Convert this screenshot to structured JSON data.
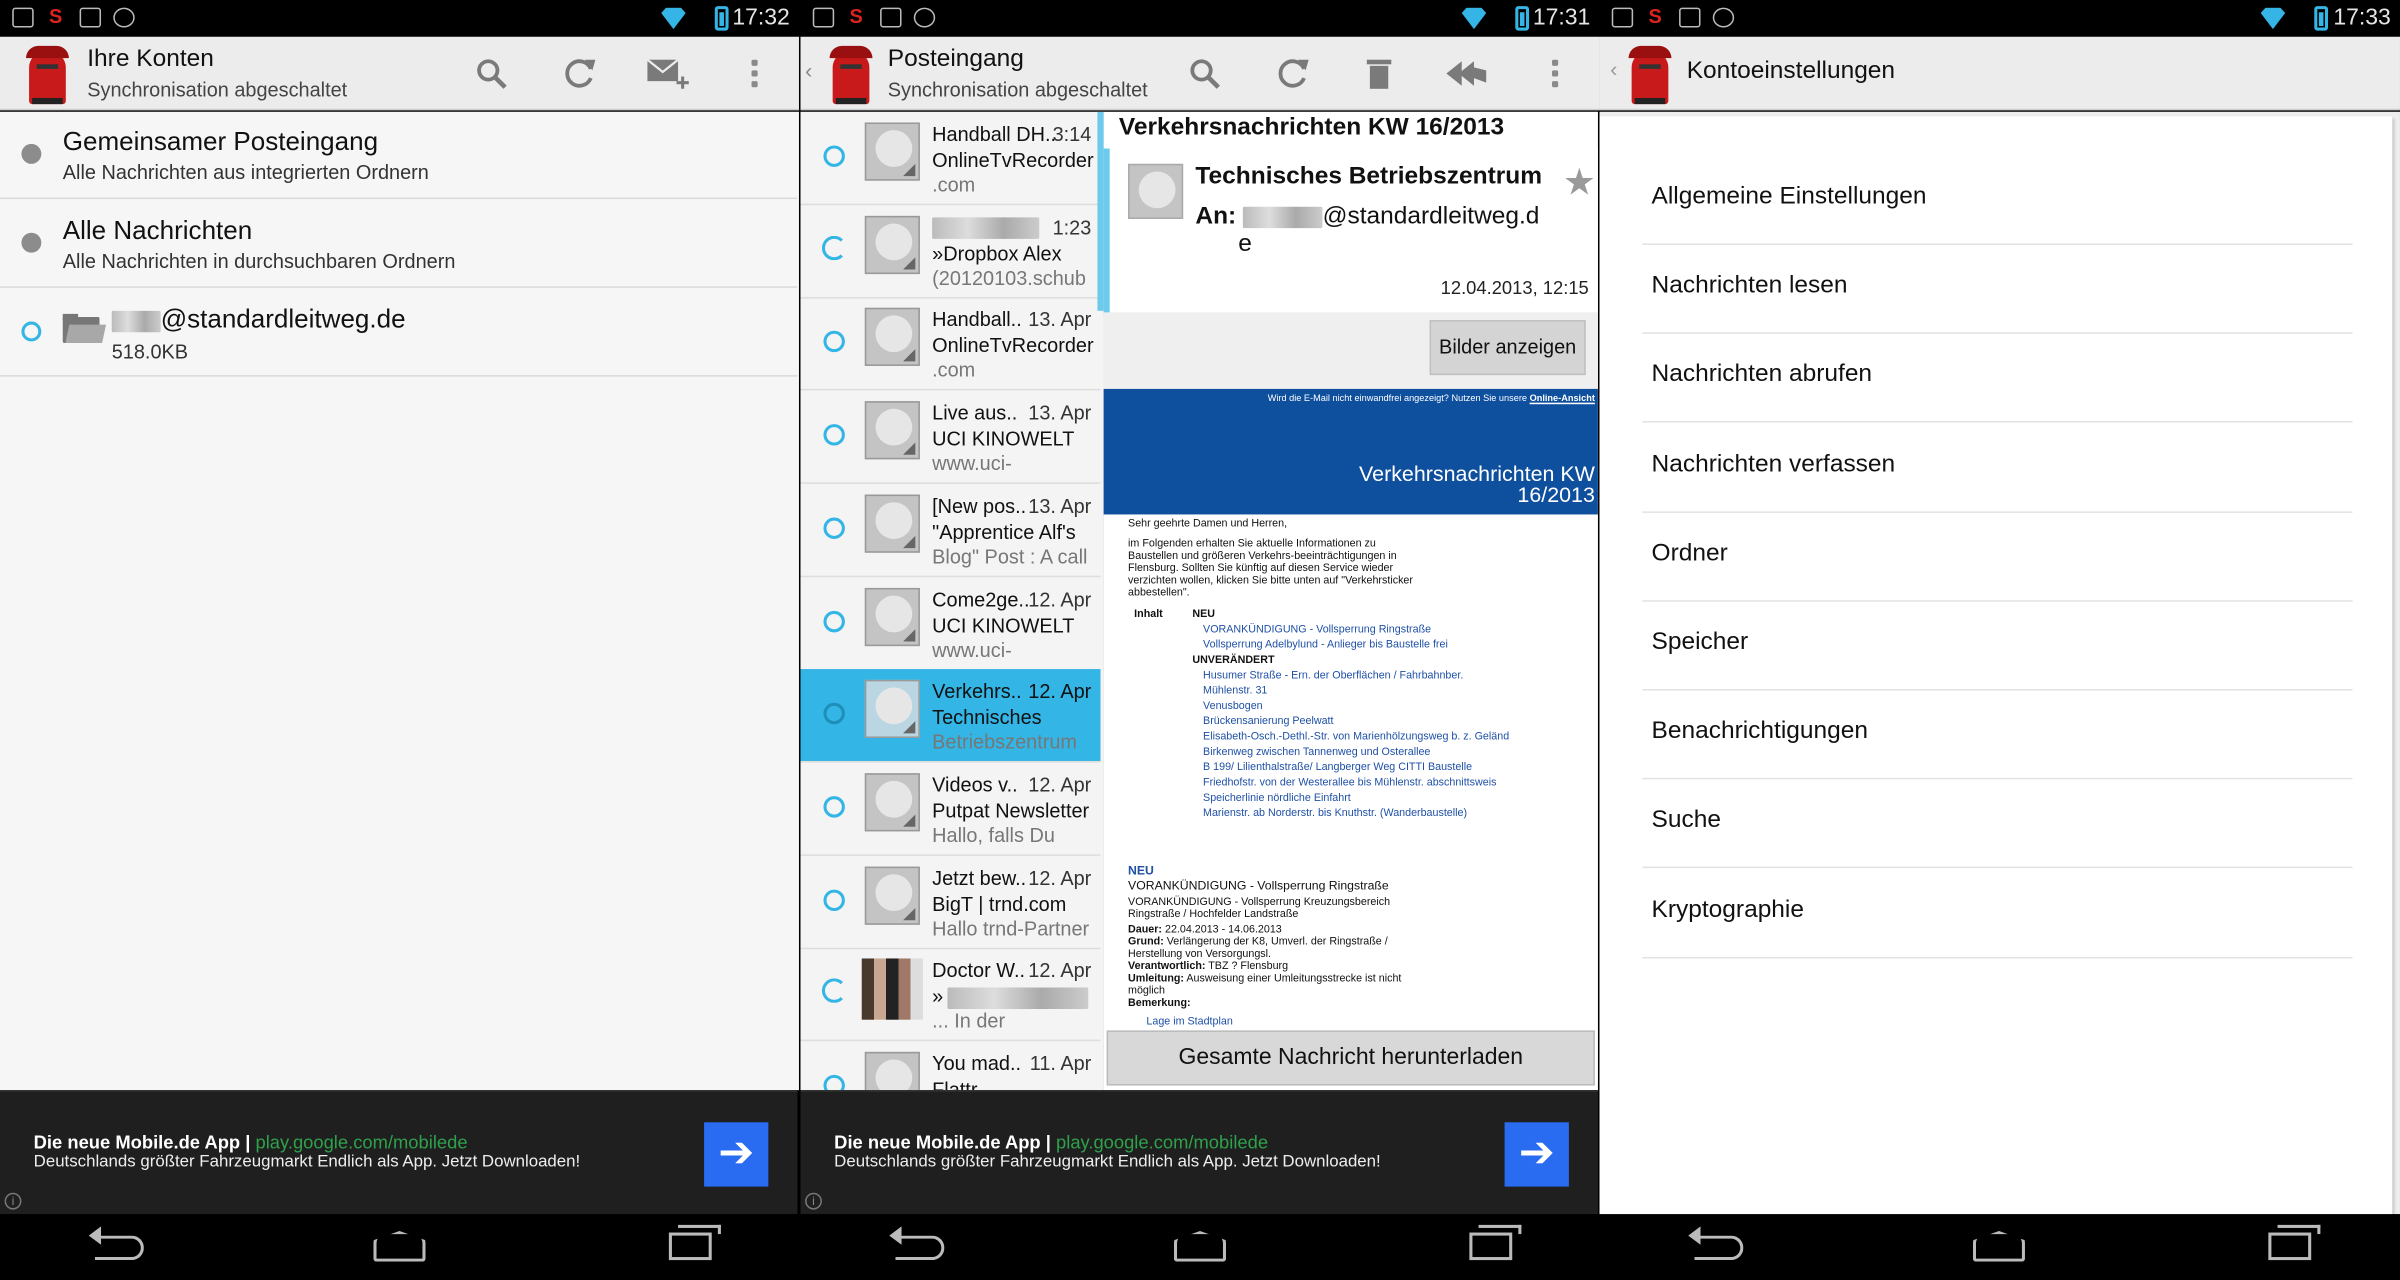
{
  "panels": {
    "accounts": {
      "status_time": "17:32",
      "title": "Ihre Konten",
      "subtitle": "Synchronisation abgeschaltet",
      "icons": [
        "search-icon",
        "refresh-icon",
        "compose-icon",
        "overflow-icon"
      ],
      "items": [
        {
          "title": "Gemeinsamer Posteingang",
          "sub": "Alle Nachrichten aus integrierten Ordnern"
        },
        {
          "title": "Alle Nachrichten",
          "sub": "Alle Nachrichten in durchsuchbaren Ordnern"
        },
        {
          "title": "@standardleitweg.de",
          "sub": "518.0KB"
        }
      ]
    },
    "inbox": {
      "status_time": "17:31",
      "title": "Posteingang",
      "subtitle": "Synchronisation abgeschaltet",
      "icons": [
        "search-icon",
        "refresh-icon",
        "trash-icon",
        "reply-all-icon",
        "overflow-icon"
      ],
      "messages": [
        {
          "from": "Handball DH..",
          "date": "3:14",
          "subject": "OnlineTvRecorder",
          "preview": ".com"
        },
        {
          "from": "",
          "date": "1:23",
          "subject": "»Dropbox Alex",
          "preview": "(20120103.schub"
        },
        {
          "from": "Handball..",
          "date": "13. Apr",
          "subject": "OnlineTvRecorder",
          "preview": ".com"
        },
        {
          "from": "Live aus..",
          "date": "13. Apr",
          "subject": "UCI KINOWELT",
          "preview": "www.uci-"
        },
        {
          "from": "[New pos..",
          "date": "13. Apr",
          "subject": "\"Apprentice Alf's",
          "preview": "Blog\" Post : A call"
        },
        {
          "from": "Come2ge..",
          "date": "12. Apr",
          "subject": "UCI KINOWELT",
          "preview": "www.uci-"
        },
        {
          "from": "Verkehrs..",
          "date": "12. Apr",
          "subject": "Technisches",
          "preview": "Betriebszentrum"
        },
        {
          "from": "Videos v..",
          "date": "12. Apr",
          "subject": "Putpat Newsletter",
          "preview": "Hallo, falls Du"
        },
        {
          "from": "Jetzt bew..",
          "date": "12. Apr",
          "subject": "BigT | trnd.com",
          "preview": "Hallo trnd-Partner"
        },
        {
          "from": "Doctor W..",
          "date": "12. Apr",
          "subject": "»",
          "preview": "... In der"
        },
        {
          "from": "You mad..",
          "date": "11. Apr",
          "subject": "Flattr",
          "preview": ""
        }
      ],
      "reader": {
        "title": "Verkehrsnachrichten KW 16/2013",
        "sender": "Technisches Betriebszentrum",
        "to_label": "An:",
        "to_address": "@standardleitweg.d",
        "to_wrap": "e",
        "date": "12.04.2013, 12:15",
        "show_images": "Bilder anzeigen",
        "banner_note": "Wird die E-Mail nicht einwandfrei angezeigt? Nutzen Sie unsere",
        "banner_link": "Online-Ansicht",
        "banner_title": "Verkehrsnachrichten KW 16/2013",
        "greeting": "Sehr geehrte Damen und Herren,",
        "intro": "im Folgenden erhalten Sie aktuelle Informationen zu Baustellen und größeren Verkehrs-beeinträchtigungen in Flensburg. Sollten Sie künftig auf diesen Service wieder verzichten wollen, klicken Sie bitte unten auf \"Verkehrsticker abbestellen\".",
        "inhalt": "Inhalt",
        "neu": "NEU",
        "neu_items": [
          "VORANKÜNDIGUNG - Vollsperrung Ringstraße",
          "Vollsperrung Adelbylund - Anlieger bis Baustelle frei"
        ],
        "unveraendert": "UNVERÄNDERT",
        "unv_items": [
          "Husumer Straße - Ern. der Oberflächen / Fahrbahnber.",
          "Mühlenstr. 31",
          "Venusbogen",
          "Brückensanierung Peelwatt",
          "Elisabeth-Osch.-Dethl.-Str. von Marienhölzungsweg b. z. Geländ",
          "Birkenweg zwischen Tannenweg und Osterallee",
          "B 199/ Lilienthalstraße/ Langberger Weg CITTI Baustelle",
          "Friedhofstr. von der Westerallee bis Mühlenstr. abschnittsweis",
          "Speicherlinie nördliche Einfahrt",
          "Marienstr. ab Norderstr. bis Knuthstr. (Wanderbaustelle)"
        ],
        "section_neu": "NEU",
        "section_title": "VORANKÜNDIGUNG - Vollsperrung Ringstraße",
        "section_lines": [
          "VORANKÜNDIGUNG - Vollsperrung Kreuzungsbereich",
          "Ringstraße / Hochfelder Landstraße"
        ],
        "dauer_label": "Dauer:",
        "dauer": "22.04.2013 - 14.06.2013",
        "grund_label": "Grund:",
        "grund": "Verlängerung der K8, Umverl. der Ringstraße / Herstellung von Versorgungsl.",
        "verantw_label": "Verantwortlich:",
        "verantw": "TBZ ? Flensburg",
        "umleitung_label": "Umleitung:",
        "umleitung": "Ausweisung einer Umleitungsstrecke ist nicht möglich",
        "bemerkung_label": "Bemerkung:",
        "map_link": "Lage im Stadtplan",
        "download": "Gesamte Nachricht herunterladen"
      }
    },
    "settings": {
      "status_time": "17:33",
      "title": "Kontoeinstellungen",
      "items": [
        "Allgemeine Einstellungen",
        "Nachrichten lesen",
        "Nachrichten abrufen",
        "Nachrichten verfassen",
        "Ordner",
        "Speicher",
        "Benachrichtigungen",
        "Suche",
        "Kryptographie"
      ]
    }
  },
  "ad": {
    "title": "Die neue Mobile.de App |",
    "link": "play.google.com/mobilede",
    "desc": "Deutschlands größter Fahrzeugmarkt Endlich als App. Jetzt Downloaden!"
  },
  "colors": {
    "accent": "#33b5e5",
    "selected": "#33b5e5",
    "banner": "#0e4f9e",
    "ad_button": "#2a6cf1",
    "ad_link": "#2fa14b"
  }
}
